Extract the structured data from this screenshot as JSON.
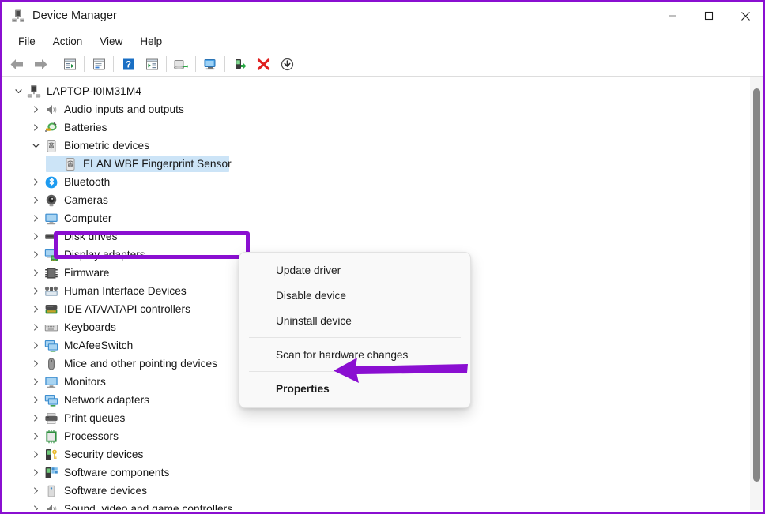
{
  "window": {
    "title": "Device Manager",
    "icon": "device-manager-icon",
    "controls": {
      "minimize": "Minimize",
      "maximize": "Maximize",
      "close": "Close"
    }
  },
  "menubar": {
    "items": [
      "File",
      "Action",
      "View",
      "Help"
    ]
  },
  "toolbar": {
    "buttons": [
      {
        "name": "back-icon",
        "title": "Back"
      },
      {
        "name": "forward-icon",
        "title": "Forward"
      },
      {
        "name": "properties-icon",
        "title": "Properties"
      },
      {
        "name": "show-hide-console-tree-icon",
        "title": "Show/Hide Console Tree"
      },
      {
        "name": "help-icon",
        "title": "Help"
      },
      {
        "name": "update-driver-icon",
        "title": "Update Driver Software"
      },
      {
        "name": "uninstall-device-icon",
        "title": "Uninstall device"
      },
      {
        "name": "scan-hardware-changes-icon",
        "title": "Scan for hardware changes"
      },
      {
        "name": "enable-device-icon",
        "title": "Enable device"
      },
      {
        "name": "disable-device-icon",
        "title": "Disable device"
      },
      {
        "name": "download-icon",
        "title": "Download"
      }
    ]
  },
  "tree": {
    "root": {
      "label": "LAPTOP-I0IM31M4",
      "icon": "computer-root-icon",
      "expanded": true
    },
    "items": [
      {
        "label": "Audio inputs and outputs",
        "icon": "speaker-icon",
        "depth": 1,
        "expanded": false
      },
      {
        "label": "Batteries",
        "icon": "battery-icon",
        "depth": 1,
        "expanded": false
      },
      {
        "label": "Biometric devices",
        "icon": "fingerprint-icon",
        "depth": 1,
        "expanded": true
      },
      {
        "label": "ELAN WBF Fingerprint Sensor",
        "icon": "fingerprint-device-icon",
        "depth": 2,
        "selected": true,
        "highlighted": true
      },
      {
        "label": "Bluetooth",
        "icon": "bluetooth-icon",
        "depth": 1,
        "expanded": false
      },
      {
        "label": "Cameras",
        "icon": "camera-icon",
        "depth": 1,
        "expanded": false
      },
      {
        "label": "Computer",
        "icon": "monitor-icon",
        "depth": 1,
        "expanded": false
      },
      {
        "label": "Disk drives",
        "icon": "disk-drive-icon",
        "depth": 1,
        "expanded": false
      },
      {
        "label": "Display adapters",
        "icon": "display-adapter-icon",
        "depth": 1,
        "expanded": false
      },
      {
        "label": "Firmware",
        "icon": "chip-icon",
        "depth": 1,
        "expanded": false
      },
      {
        "label": "Human Interface Devices",
        "icon": "hid-icon",
        "depth": 1,
        "expanded": false
      },
      {
        "label": "IDE ATA/ATAPI controllers",
        "icon": "ide-controller-icon",
        "depth": 1,
        "expanded": false
      },
      {
        "label": "Keyboards",
        "icon": "keyboard-icon",
        "depth": 1,
        "expanded": false
      },
      {
        "label": "McAfeeSwitch",
        "icon": "network-icon",
        "depth": 1,
        "expanded": false
      },
      {
        "label": "Mice and other pointing devices",
        "icon": "mouse-icon",
        "depth": 1,
        "expanded": false
      },
      {
        "label": "Monitors",
        "icon": "monitor-icon",
        "depth": 1,
        "expanded": false
      },
      {
        "label": "Network adapters",
        "icon": "network-icon",
        "depth": 1,
        "expanded": false
      },
      {
        "label": "Print queues",
        "icon": "printer-icon",
        "depth": 1,
        "expanded": false
      },
      {
        "label": "Processors",
        "icon": "processor-icon",
        "depth": 1,
        "expanded": false
      },
      {
        "label": "Security devices",
        "icon": "security-key-icon",
        "depth": 1,
        "expanded": false
      },
      {
        "label": "Software components",
        "icon": "software-component-icon",
        "depth": 1,
        "expanded": false
      },
      {
        "label": "Software devices",
        "icon": "software-device-icon",
        "depth": 1,
        "expanded": false
      },
      {
        "label": "Sound, video and game controllers",
        "icon": "sound-controller-icon",
        "depth": 1,
        "expanded": false
      }
    ]
  },
  "context_menu": {
    "items": [
      {
        "label": "Update driver",
        "bold": false
      },
      {
        "label": "Disable device",
        "bold": false
      },
      {
        "label": "Uninstall device",
        "bold": false
      },
      {
        "separator_after": true
      },
      {
        "label": "Scan for hardware changes",
        "bold": false
      },
      {
        "separator_after": true
      },
      {
        "label": "Properties",
        "bold": true
      }
    ]
  },
  "annotations": {
    "highlight_color": "#8a0fd1",
    "arrow_color": "#8a0fd1",
    "highlight_target": "ELAN WBF Fingerprint Sensor",
    "arrow_target": "Properties"
  },
  "colors": {
    "selection_bg": "#cce4f7",
    "window_border": "#8a0fd1",
    "menu_bg": "#f9f9f9",
    "scrollbar_thumb": "#868686"
  }
}
